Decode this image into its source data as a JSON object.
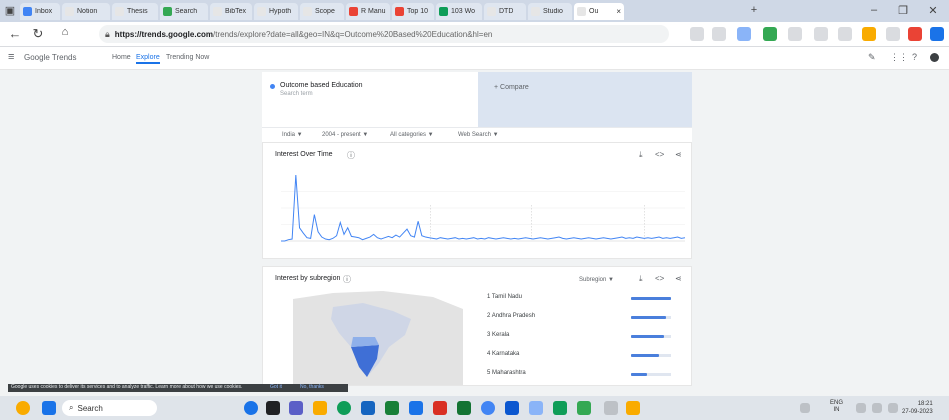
{
  "browser": {
    "tabs": [
      {
        "label": "Inbox",
        "color": "#4285f4"
      },
      {
        "label": "Notion",
        "color": "#e6e6e6"
      },
      {
        "label": "Thesis",
        "color": "#e6e6e6"
      },
      {
        "label": "Search",
        "color": "#34a853"
      },
      {
        "label": "BibTex",
        "color": "#e6e6e6"
      },
      {
        "label": "Hypoth",
        "color": "#e6e6e6"
      },
      {
        "label": "Scope",
        "color": "#e6e6e6"
      },
      {
        "label": "R Manu",
        "color": "#ea4335"
      },
      {
        "label": "Top 10",
        "color": "#ea4335"
      },
      {
        "label": "103 Wo",
        "color": "#0f9d58"
      },
      {
        "label": "DTD",
        "color": "#e6e6e6"
      },
      {
        "label": "Studio",
        "color": "#e6e6e6"
      },
      {
        "label": "Ou",
        "color": "#e6e6e6",
        "active": true
      }
    ],
    "tab_close": "×",
    "new_tab": "+",
    "url_host": "https://trends.google.com",
    "url_path": "/trends/explore?date=all&geo=IN&q=Outcome%20Based%20Education&hl=en"
  },
  "trends": {
    "title": "Google Trends",
    "nav": [
      "Home",
      "Explore",
      "Trending Now"
    ],
    "active_nav": "Explore"
  },
  "compare": {
    "term": "Outcome based Education",
    "term_sub": "Search term",
    "add": "+ Compare"
  },
  "filters": [
    "India ▼",
    "2004 - present ▼",
    "All categories ▼",
    "Web Search ▼"
  ],
  "interest_over_time": {
    "title": "Interest Over Time"
  },
  "chart_data": {
    "type": "line",
    "title": "Interest Over Time",
    "ylim": [
      0,
      100
    ],
    "series": [
      {
        "values": [
          0,
          0,
          2,
          3,
          100,
          20,
          12,
          5,
          4,
          40,
          14,
          6,
          3,
          2,
          4,
          8,
          28,
          10,
          20,
          7,
          6,
          5,
          2,
          4,
          6,
          10,
          5,
          3,
          5,
          7,
          5,
          9,
          6,
          12,
          18,
          8,
          6,
          30,
          8,
          6,
          5,
          4,
          3,
          5,
          4,
          3,
          4,
          5,
          3,
          4,
          3,
          4,
          5,
          3,
          4,
          3,
          5,
          4,
          3,
          4,
          5,
          4,
          3,
          4,
          3,
          4,
          5,
          4,
          3,
          4,
          5,
          4,
          3,
          4,
          5,
          6,
          4,
          3,
          4,
          5,
          4,
          3,
          4,
          5,
          4,
          3,
          4,
          5,
          4,
          3,
          4,
          5,
          6,
          4,
          5,
          4,
          6,
          5,
          4,
          5,
          4,
          5,
          6,
          4,
          5,
          4,
          5,
          6,
          4,
          5
        ]
      }
    ]
  },
  "interest_by_subregion": {
    "title": "Interest by subregion",
    "sort": "Subregion ▼",
    "regions": [
      {
        "rank": "1",
        "name": "Tamil Nadu",
        "value": 100
      },
      {
        "rank": "2",
        "name": "Andhra Pradesh",
        "value": 88
      },
      {
        "rank": "3",
        "name": "Kerala",
        "value": 82
      },
      {
        "rank": "4",
        "name": "Karnataka",
        "value": 70
      },
      {
        "rank": "5",
        "name": "Maharashtra",
        "value": 40
      }
    ]
  },
  "cookie": {
    "text": "Google uses cookies to deliver its services and to analyze traffic. Learn more about how we use cookies.",
    "ok": "Got it",
    "more": "No, thanks"
  },
  "taskbar": {
    "search_placeholder": "Search",
    "lang_top": "ENG",
    "lang_bottom": "IN",
    "time": "18:21",
    "date": "27-09-2023"
  }
}
